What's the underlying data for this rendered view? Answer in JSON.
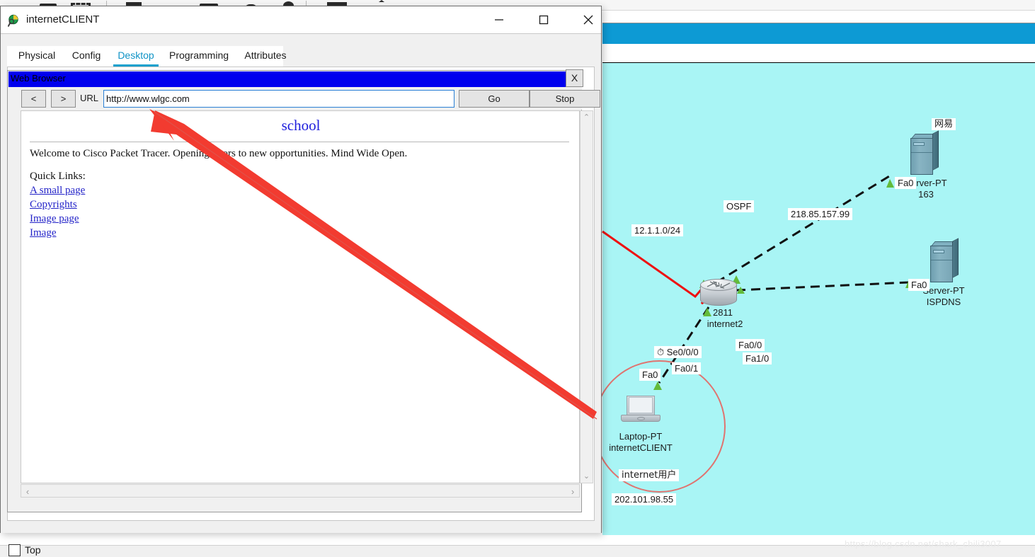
{
  "dialog": {
    "title": "internetCLIENT",
    "icon": "packet-tracer-icon",
    "window_controls": {
      "minimize": "minimize-icon",
      "maximize": "maximize-icon",
      "close": "close-icon"
    },
    "tabs": [
      {
        "label": "Physical",
        "active": false
      },
      {
        "label": "Config",
        "active": false
      },
      {
        "label": "Desktop",
        "active": true
      },
      {
        "label": "Programming",
        "active": false
      },
      {
        "label": "Attributes",
        "active": false
      }
    ],
    "top_checkbox": {
      "label": "Top",
      "checked": false
    }
  },
  "browser": {
    "window_title": "Web Browser",
    "close_label": "X",
    "back_label": "<",
    "forward_label": ">",
    "url_label": "URL",
    "url_value": "http://www.wlgc.com",
    "url_placeholder": "http://",
    "go_label": "Go",
    "stop_label": "Stop",
    "page": {
      "heading": "school",
      "welcome": "Welcome to Cisco Packet Tracer. Opening doors to new opportunities. Mind Wide Open.",
      "quick_links_label": "Quick Links:",
      "links": [
        "A small page",
        "Copyrights",
        "Image page",
        "Image"
      ]
    },
    "scroll": {
      "up": "⌃",
      "down": "⌄",
      "left": "‹",
      "right": "›"
    }
  },
  "topology": {
    "background_color": "#a9f5f5",
    "accent_bar_color": "#0d9ad4",
    "annotations": [
      {
        "id": "wan-subnet",
        "text": "12.1.1.0/24"
      },
      {
        "id": "routing-protocol",
        "text": "OSPF"
      },
      {
        "id": "isp-link-ip",
        "text": "218.85.157.99"
      },
      {
        "id": "client-public-ip",
        "text": "202.101.98.55"
      },
      {
        "id": "client-group",
        "text": "internet用户"
      },
      {
        "id": "server-163-brand",
        "text": "网易"
      }
    ],
    "interfaces": [
      {
        "id": "se000",
        "text": "Se0/0/0",
        "clock": true
      },
      {
        "id": "fa01",
        "text": "Fa0/1"
      },
      {
        "id": "fa00",
        "text": "Fa0/0"
      },
      {
        "id": "fa10",
        "text": "Fa1/0"
      },
      {
        "id": "fa0-163",
        "text": "Fa0"
      },
      {
        "id": "fa0-ispdns",
        "text": "Fa0"
      },
      {
        "id": "fa0-laptop",
        "text": "Fa0"
      }
    ],
    "devices": [
      {
        "id": "router-internet2",
        "model": "2811",
        "name": "internet2",
        "type": "router"
      },
      {
        "id": "server-163",
        "model": "Server-PT",
        "name": "163",
        "type": "server"
      },
      {
        "id": "server-ispdns",
        "model": "Server-PT",
        "name": "ISPDNS",
        "type": "server"
      },
      {
        "id": "laptop-client",
        "model": "Laptop-PT",
        "name": "internetCLIENT",
        "type": "laptop"
      }
    ]
  },
  "watermark": "https://blog.csdn.net/shark_chili3007"
}
